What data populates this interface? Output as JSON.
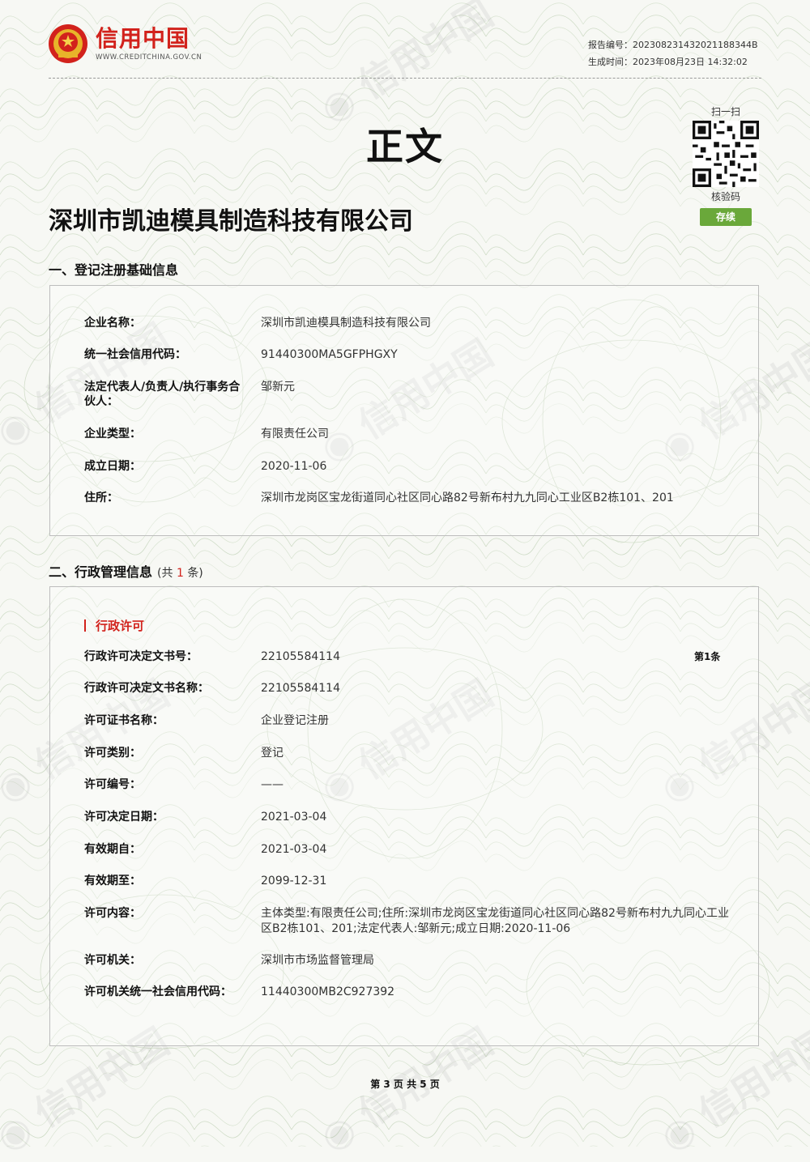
{
  "header": {
    "logo_text": "信用中国",
    "logo_url": "WWW.CREDITCHINA.GOV.CN",
    "report_no_label": "报告编号：",
    "report_no": "2023082314320211883 44B",
    "generated_label": "生成时间：",
    "generated_time": "2023年08月23日 14:32:02"
  },
  "qr": {
    "top_label": "扫一扫",
    "bottom_label": "核验码",
    "status_button": "存续"
  },
  "title": "正文",
  "company_name": "深圳市凯迪模具制造科技有限公司",
  "section1": {
    "title": "一、登记注册基础信息",
    "rows": [
      {
        "label": "企业名称：",
        "value": "深圳市凯迪模具制造科技有限公司"
      },
      {
        "label": "统一社会信用代码：",
        "value": "91440300MA5GFPHGXY"
      },
      {
        "label": "法定代表人/负责人/执行事务合伙人：",
        "value": "邹新元"
      },
      {
        "label": "企业类型：",
        "value": "有限责任公司"
      },
      {
        "label": "成立日期：",
        "value": "2020-11-06"
      },
      {
        "label": "住所：",
        "value": "深圳市龙岗区宝龙街道同心社区同心路82号新布村九九同心工业区B2栋101、201"
      }
    ]
  },
  "section2": {
    "title": "二、行政管理信息",
    "count_prefix": "(共",
    "count": "1",
    "count_suffix": "条)",
    "subheading": "行政许可",
    "item_no": "第1条",
    "rows": [
      {
        "label": "行政许可决定文书号：",
        "value": "22105584114"
      },
      {
        "label": "行政许可决定文书名称：",
        "value": "22105584114"
      },
      {
        "label": "许可证书名称：",
        "value": "企业登记注册"
      },
      {
        "label": "许可类别：",
        "value": "登记"
      },
      {
        "label": "许可编号：",
        "value": "——"
      },
      {
        "label": "许可决定日期：",
        "value": "2021-03-04"
      },
      {
        "label": "有效期自：",
        "value": "2021-03-04"
      },
      {
        "label": "有效期至：",
        "value": "2099-12-31"
      },
      {
        "label": "许可内容：",
        "value": "主体类型:有限责任公司;住所:深圳市龙岗区宝龙街道同心社区同心路82号新布村九九同心工业区B2栋101、201;法定代表人:邹新元;成立日期:2020-11-06"
      },
      {
        "label": "许可机关：",
        "value": "深圳市市场监督管理局"
      },
      {
        "label": "许可机关统一社会信用代码：",
        "value": "11440300MB2C927392"
      }
    ]
  },
  "footer": "第 3 页  共 5 页",
  "colors": {
    "brand_red": "#d2221c",
    "status_green": "#6aa83a"
  }
}
